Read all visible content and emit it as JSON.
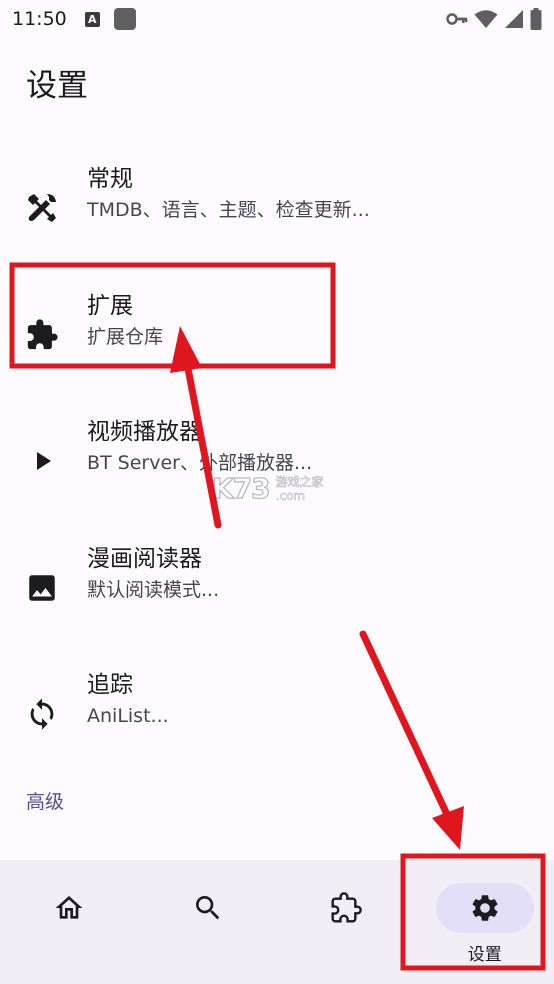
{
  "status_bar": {
    "time": "11:50",
    "notification_letter": "A",
    "icons": [
      "vpn-key-icon",
      "wifi-icon",
      "signal-icon",
      "battery-icon"
    ]
  },
  "page": {
    "title": "设置"
  },
  "settings": [
    {
      "title": "常规",
      "subtitle": "TMDB、语言、主题、检查更新...",
      "icon": "tools-icon"
    },
    {
      "title": "扩展",
      "subtitle": "扩展仓库",
      "icon": "puzzle-icon"
    },
    {
      "title": "视频播放器",
      "subtitle": "BT Server、外部播放器...",
      "icon": "play-icon"
    },
    {
      "title": "漫画阅读器",
      "subtitle": "默认阅读模式...",
      "icon": "image-icon"
    },
    {
      "title": "追踪",
      "subtitle": "AniList...",
      "icon": "sync-icon"
    }
  ],
  "section": {
    "advanced_label": "高级"
  },
  "bottom_nav": {
    "items": [
      {
        "icon": "home-icon",
        "label": ""
      },
      {
        "icon": "search-icon",
        "label": ""
      },
      {
        "icon": "extension-icon",
        "label": ""
      },
      {
        "icon": "gear-icon",
        "label": "设置",
        "active": true
      }
    ]
  },
  "watermark": {
    "logo": "K73",
    "cn": "游戏之家",
    "domain": ".com"
  },
  "colors": {
    "background": "#FEFBFF",
    "accent": "#5A4D91",
    "nav_background": "#F2EEF6",
    "nav_pill": "#E3DFF8",
    "annotation_red": "#E0161E"
  }
}
